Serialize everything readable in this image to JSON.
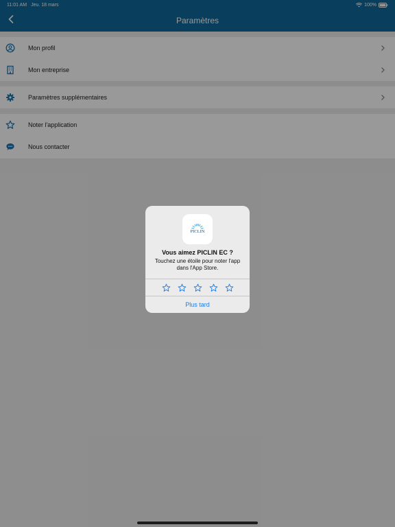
{
  "status_bar": {
    "time": "11:01 AM",
    "date": "Jeu. 18 mars",
    "battery": "100%"
  },
  "nav": {
    "title": "Paramètres",
    "back_icon": "chevron-left-icon"
  },
  "settings": {
    "group1": [
      {
        "label": "Mon profil",
        "icon": "user-circle-icon"
      },
      {
        "label": "Mon entreprise",
        "icon": "building-icon"
      }
    ],
    "group2": [
      {
        "label": "Paramètres supplémentaires",
        "icon": "gear-icon"
      }
    ],
    "group3": [
      {
        "label": "Noter l'application",
        "icon": "star-icon"
      },
      {
        "label": "Nous contacter",
        "icon": "chat-bubble-icon"
      }
    ]
  },
  "rating_alert": {
    "app_logo_text": "PICLIN",
    "title": "Vous aimez PICLIN EC ?",
    "message": "Touchez une étoile pour noter l'app dans l'App Store.",
    "star_count": 5,
    "later_label": "Plus tard"
  },
  "colors": {
    "nav_blue": "#0f6a9b",
    "accent_icon": "#1b75b1",
    "link_blue": "#1c7ce6"
  }
}
